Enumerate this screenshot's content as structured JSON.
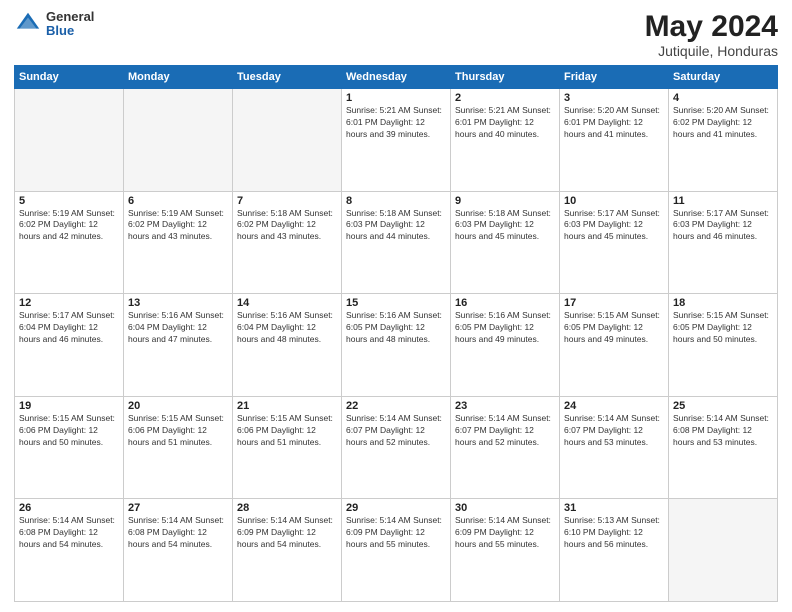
{
  "header": {
    "logo_general": "General",
    "logo_blue": "Blue",
    "month_year": "May 2024",
    "location": "Jutiquile, Honduras"
  },
  "days_of_week": [
    "Sunday",
    "Monday",
    "Tuesday",
    "Wednesday",
    "Thursday",
    "Friday",
    "Saturday"
  ],
  "weeks": [
    [
      {
        "day": "",
        "info": ""
      },
      {
        "day": "",
        "info": ""
      },
      {
        "day": "",
        "info": ""
      },
      {
        "day": "1",
        "info": "Sunrise: 5:21 AM\nSunset: 6:01 PM\nDaylight: 12 hours\nand 39 minutes."
      },
      {
        "day": "2",
        "info": "Sunrise: 5:21 AM\nSunset: 6:01 PM\nDaylight: 12 hours\nand 40 minutes."
      },
      {
        "day": "3",
        "info": "Sunrise: 5:20 AM\nSunset: 6:01 PM\nDaylight: 12 hours\nand 41 minutes."
      },
      {
        "day": "4",
        "info": "Sunrise: 5:20 AM\nSunset: 6:02 PM\nDaylight: 12 hours\nand 41 minutes."
      }
    ],
    [
      {
        "day": "5",
        "info": "Sunrise: 5:19 AM\nSunset: 6:02 PM\nDaylight: 12 hours\nand 42 minutes."
      },
      {
        "day": "6",
        "info": "Sunrise: 5:19 AM\nSunset: 6:02 PM\nDaylight: 12 hours\nand 43 minutes."
      },
      {
        "day": "7",
        "info": "Sunrise: 5:18 AM\nSunset: 6:02 PM\nDaylight: 12 hours\nand 43 minutes."
      },
      {
        "day": "8",
        "info": "Sunrise: 5:18 AM\nSunset: 6:03 PM\nDaylight: 12 hours\nand 44 minutes."
      },
      {
        "day": "9",
        "info": "Sunrise: 5:18 AM\nSunset: 6:03 PM\nDaylight: 12 hours\nand 45 minutes."
      },
      {
        "day": "10",
        "info": "Sunrise: 5:17 AM\nSunset: 6:03 PM\nDaylight: 12 hours\nand 45 minutes."
      },
      {
        "day": "11",
        "info": "Sunrise: 5:17 AM\nSunset: 6:03 PM\nDaylight: 12 hours\nand 46 minutes."
      }
    ],
    [
      {
        "day": "12",
        "info": "Sunrise: 5:17 AM\nSunset: 6:04 PM\nDaylight: 12 hours\nand 46 minutes."
      },
      {
        "day": "13",
        "info": "Sunrise: 5:16 AM\nSunset: 6:04 PM\nDaylight: 12 hours\nand 47 minutes."
      },
      {
        "day": "14",
        "info": "Sunrise: 5:16 AM\nSunset: 6:04 PM\nDaylight: 12 hours\nand 48 minutes."
      },
      {
        "day": "15",
        "info": "Sunrise: 5:16 AM\nSunset: 6:05 PM\nDaylight: 12 hours\nand 48 minutes."
      },
      {
        "day": "16",
        "info": "Sunrise: 5:16 AM\nSunset: 6:05 PM\nDaylight: 12 hours\nand 49 minutes."
      },
      {
        "day": "17",
        "info": "Sunrise: 5:15 AM\nSunset: 6:05 PM\nDaylight: 12 hours\nand 49 minutes."
      },
      {
        "day": "18",
        "info": "Sunrise: 5:15 AM\nSunset: 6:05 PM\nDaylight: 12 hours\nand 50 minutes."
      }
    ],
    [
      {
        "day": "19",
        "info": "Sunrise: 5:15 AM\nSunset: 6:06 PM\nDaylight: 12 hours\nand 50 minutes."
      },
      {
        "day": "20",
        "info": "Sunrise: 5:15 AM\nSunset: 6:06 PM\nDaylight: 12 hours\nand 51 minutes."
      },
      {
        "day": "21",
        "info": "Sunrise: 5:15 AM\nSunset: 6:06 PM\nDaylight: 12 hours\nand 51 minutes."
      },
      {
        "day": "22",
        "info": "Sunrise: 5:14 AM\nSunset: 6:07 PM\nDaylight: 12 hours\nand 52 minutes."
      },
      {
        "day": "23",
        "info": "Sunrise: 5:14 AM\nSunset: 6:07 PM\nDaylight: 12 hours\nand 52 minutes."
      },
      {
        "day": "24",
        "info": "Sunrise: 5:14 AM\nSunset: 6:07 PM\nDaylight: 12 hours\nand 53 minutes."
      },
      {
        "day": "25",
        "info": "Sunrise: 5:14 AM\nSunset: 6:08 PM\nDaylight: 12 hours\nand 53 minutes."
      }
    ],
    [
      {
        "day": "26",
        "info": "Sunrise: 5:14 AM\nSunset: 6:08 PM\nDaylight: 12 hours\nand 54 minutes."
      },
      {
        "day": "27",
        "info": "Sunrise: 5:14 AM\nSunset: 6:08 PM\nDaylight: 12 hours\nand 54 minutes."
      },
      {
        "day": "28",
        "info": "Sunrise: 5:14 AM\nSunset: 6:09 PM\nDaylight: 12 hours\nand 54 minutes."
      },
      {
        "day": "29",
        "info": "Sunrise: 5:14 AM\nSunset: 6:09 PM\nDaylight: 12 hours\nand 55 minutes."
      },
      {
        "day": "30",
        "info": "Sunrise: 5:14 AM\nSunset: 6:09 PM\nDaylight: 12 hours\nand 55 minutes."
      },
      {
        "day": "31",
        "info": "Sunrise: 5:13 AM\nSunset: 6:10 PM\nDaylight: 12 hours\nand 56 minutes."
      },
      {
        "day": "",
        "info": ""
      }
    ]
  ]
}
